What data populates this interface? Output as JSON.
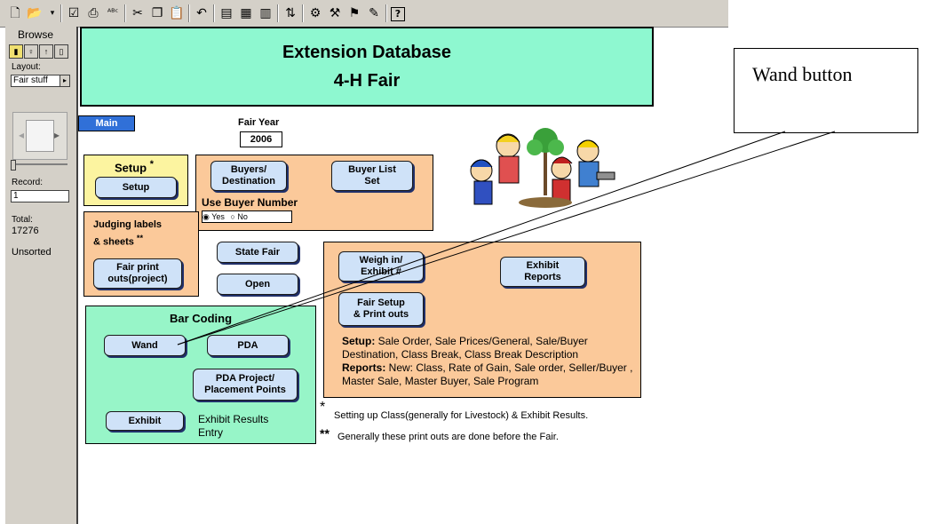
{
  "toolbar": {
    "icons": [
      "new-file-icon",
      "open-folder-icon",
      "dropdown-arrow-icon",
      "check-icon",
      "print-icon",
      "spell-check-icon",
      "cut-icon",
      "copy-icon",
      "paste-icon",
      "undo-icon",
      "layout-a-icon",
      "layout-b-icon",
      "layout-c-icon",
      "sort-icon",
      "field-icon",
      "tool-a-icon",
      "tool-b-icon",
      "tool-c-icon",
      "help-icon"
    ]
  },
  "sidebar": {
    "mode": "Browse",
    "layout_label": "Layout:",
    "layout_value": "Fair stuff",
    "record_label": "Record:",
    "record_value": "1",
    "total_label": "Total:",
    "total_value": "17276",
    "sort_status": "Unsorted"
  },
  "header": {
    "title": "Extension Database",
    "subtitle": "4-H Fair"
  },
  "main_button": "Main",
  "fair_year": {
    "label": "Fair Year",
    "value": "2006"
  },
  "setup": {
    "title": "Setup",
    "star": "*",
    "button": "Setup"
  },
  "buyers": {
    "buyers_button": "Buyers/\nDestination",
    "buyer_list_button": "Buyer List\nSet",
    "use_buyer_label": "Use Buyer Number",
    "option_yes": "Yes",
    "option_no": "No",
    "selected": "Yes"
  },
  "judging": {
    "title_line1": "Judging labels",
    "title_line2": "& sheets",
    "stars": "**",
    "button": "Fair print\nouts(project)"
  },
  "state_fair_button": "State Fair",
  "open_button": "Open",
  "weigh": {
    "weigh_button": "Weigh in/\nExhibit #",
    "exhibit_reports_button": "Exhibit\nReports",
    "fair_setup_button": "Fair Setup\n& Print outs",
    "setup_label": "Setup:",
    "setup_text": " Sale Order, Sale Prices/General, Sale/Buyer Destination, Class Break, Class Break Description",
    "reports_label": "Reports:",
    "reports_text": " New: Class, Rate of Gain, Sale order, Seller/Buyer , Master Sale, Master Buyer, Sale Program"
  },
  "bar_coding": {
    "title": "Bar Coding",
    "wand_button": "Wand",
    "pda_button": "PDA",
    "pda_project_button": "PDA Project/\nPlacement Points",
    "exhibit_button": "Exhibit",
    "exhibit_results_text": "Exhibit Results\nEntry"
  },
  "notes": {
    "star1": "*",
    "note1": "Setting up Class(generally for Livestock) & Exhibit Results.",
    "star2": "**",
    "note2": "Generally these print outs are done before the Fair."
  },
  "callout": {
    "text": "Wand button"
  }
}
